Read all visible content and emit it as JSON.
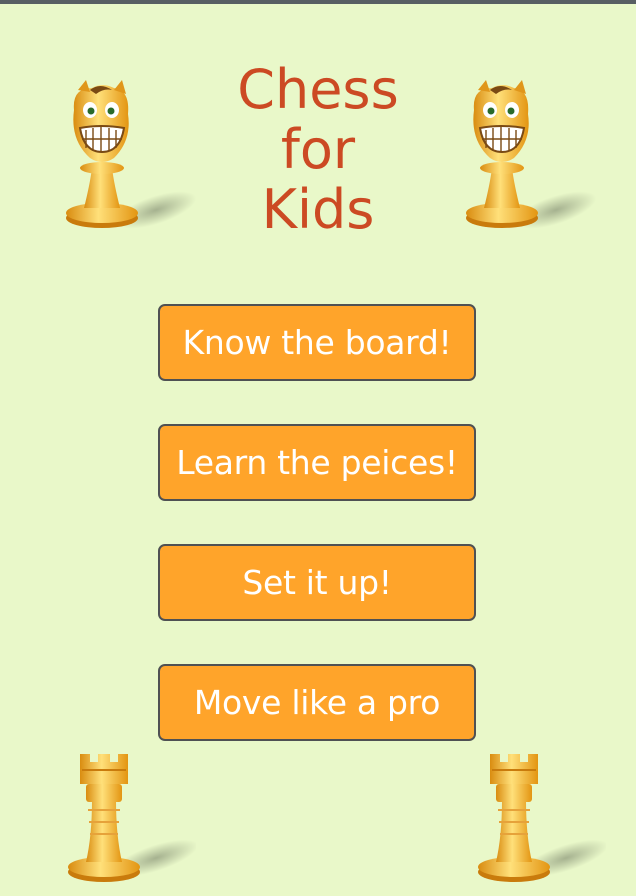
{
  "title": {
    "line1": "Chess",
    "line2": "for",
    "line3": "Kids"
  },
  "menu": {
    "items": [
      {
        "label": "Know the board!"
      },
      {
        "label": "Learn the peices!"
      },
      {
        "label": "Set it up!"
      },
      {
        "label": "Move like a pro"
      }
    ]
  },
  "icons": {
    "top_pieces": "knight-cartoon-icon",
    "bottom_pieces": "rook-icon"
  },
  "colors": {
    "background": "#e9f8c9",
    "title": "#cc4a23",
    "button": "#ffa42a",
    "button_border": "#4f5153",
    "button_text": "#ffffff"
  }
}
